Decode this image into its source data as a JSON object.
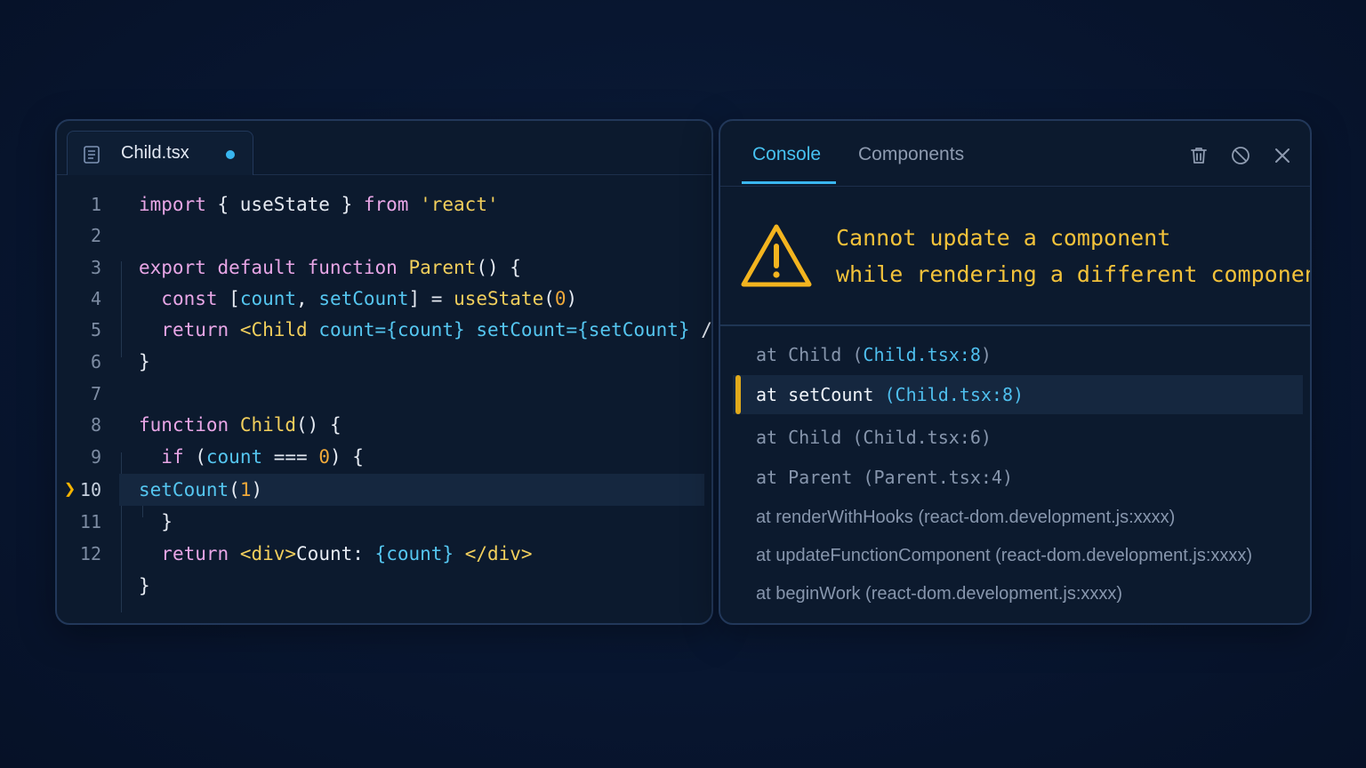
{
  "editor": {
    "tab": {
      "filename": "Child.tsx",
      "icon": "file-code-icon",
      "modified": true
    },
    "active_line": 10,
    "lines": [
      {
        "n": "1",
        "tokens": [
          [
            "kw",
            "import"
          ],
          [
            "pl",
            " { useState } "
          ],
          [
            "kw",
            "from"
          ],
          [
            "pl",
            " "
          ],
          [
            "str",
            "'react'"
          ]
        ]
      },
      {
        "n": "2",
        "tokens": []
      },
      {
        "n": "3",
        "tokens": [
          [
            "kw",
            "export default function"
          ],
          [
            "pl",
            " "
          ],
          [
            "fn",
            "Parent"
          ],
          [
            "pl",
            "() {"
          ]
        ]
      },
      {
        "n": "4",
        "tokens": [
          [
            "pl",
            "  "
          ],
          [
            "kw",
            "const"
          ],
          [
            "pl",
            " ["
          ],
          [
            "id",
            "count"
          ],
          [
            "pl",
            ", "
          ],
          [
            "id",
            "setCount"
          ],
          [
            "pl",
            "] = "
          ],
          [
            "fn",
            "useState"
          ],
          [
            "pl",
            "("
          ],
          [
            "num",
            "0"
          ],
          [
            "pl",
            ")"
          ]
        ]
      },
      {
        "n": "5",
        "tokens": [
          [
            "pl",
            "  "
          ],
          [
            "kw",
            "return"
          ],
          [
            "pl",
            " "
          ],
          [
            "fn",
            "<Child"
          ],
          [
            "pl",
            " "
          ],
          [
            "id",
            "count={count}"
          ],
          [
            "pl",
            " "
          ],
          [
            "id",
            "setCount={setCount}"
          ],
          [
            "pl",
            " />"
          ]
        ]
      },
      {
        "n": "6",
        "tokens": [
          [
            "pl",
            "}"
          ]
        ]
      },
      {
        "n": "7",
        "tokens": []
      },
      {
        "n": "8",
        "tokens": [
          [
            "kw",
            "function"
          ],
          [
            "pl",
            " "
          ],
          [
            "fn",
            "Child"
          ],
          [
            "pl",
            "() {"
          ]
        ]
      },
      {
        "n": "9",
        "tokens": [
          [
            "pl",
            "  "
          ],
          [
            "kw",
            "if"
          ],
          [
            "pl",
            " ("
          ],
          [
            "id",
            "count"
          ],
          [
            "pl",
            " === "
          ],
          [
            "num",
            "0"
          ],
          [
            "pl",
            ") {"
          ]
        ]
      },
      {
        "n": "10",
        "tokens": [
          [
            "id",
            "setCount"
          ],
          [
            "pl",
            "("
          ],
          [
            "num",
            "1"
          ],
          [
            "pl",
            ")"
          ]
        ]
      },
      {
        "n": "11",
        "tokens": [
          [
            "pl",
            "  }"
          ]
        ]
      },
      {
        "n": "12",
        "tokens": [
          [
            "pl",
            "  "
          ],
          [
            "kw",
            "return"
          ],
          [
            "pl",
            " "
          ],
          [
            "fn",
            "<div>"
          ],
          [
            "pl",
            "Count: "
          ],
          [
            "id",
            "{count}"
          ],
          [
            "pl",
            " "
          ],
          [
            "fn",
            "</div>"
          ]
        ]
      },
      {
        "n": "",
        "tokens": [
          [
            "pl",
            "}"
          ]
        ]
      }
    ]
  },
  "devtools": {
    "tabs": [
      "Console",
      "Components"
    ],
    "active_tab": "Console",
    "toolbar_icons": [
      "trash-icon",
      "clear-icon",
      "close-icon"
    ],
    "error": {
      "icon": "warning-triangle-icon",
      "line1": "Cannot update a component",
      "line2": "while rendering a different component"
    },
    "stack": [
      {
        "pre": "at ",
        "fn": "Child",
        "loc": "(Child.tsx:8)",
        "loc_highlight": true,
        "highlight": false
      },
      {
        "pre": "at ",
        "fn": "setCount",
        "loc": "(Child.tsx:8)",
        "loc_highlight": true,
        "highlight": true
      },
      {
        "pre": "at ",
        "fn": "Child",
        "loc": "(Child.tsx:6)",
        "loc_highlight": false,
        "highlight": false
      },
      {
        "pre": "at ",
        "fn": "Parent",
        "loc": "(Parent.tsx:4)",
        "loc_highlight": false,
        "highlight": false
      },
      {
        "pre": "at ",
        "fn": "renderWithHooks",
        "loc": "(react-dom.development.js:xxxx)",
        "loc_highlight": false,
        "highlight": false
      },
      {
        "pre": "at ",
        "fn": "updateFunctionComponent",
        "loc": "(react-dom.development.js:xxxx)",
        "loc_highlight": false,
        "highlight": false
      },
      {
        "pre": "at ",
        "fn": "beginWork",
        "loc": "(react-dom.development.js:xxxx)",
        "loc_highlight": false,
        "highlight": false
      }
    ]
  },
  "colors": {
    "background": "#081630",
    "panel": "#0c1a2e",
    "accent_blue": "#3ab6ef",
    "warning": "#f3c23a",
    "keyword": "#e8a6e6",
    "function": "#f2cf5c",
    "identifier": "#55c6f0",
    "number": "#f0a93a"
  }
}
